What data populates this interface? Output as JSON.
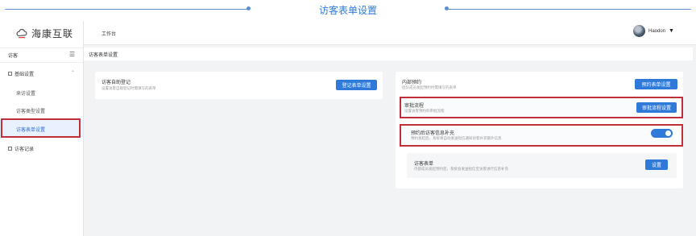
{
  "banner": {
    "title": "访客表单设置"
  },
  "sidebar": {
    "logo_text": "海康互联",
    "section_title": "访客",
    "groups": [
      {
        "label": "基础设置",
        "items": [
          "来访设置",
          "访客类型设置",
          "访客表单设置"
        ]
      },
      {
        "label": "访客记录",
        "items": []
      }
    ]
  },
  "header": {
    "breadcrumb": "工作台",
    "user_name": "Haodon"
  },
  "page": {
    "title": "访客表单设置"
  },
  "left_card": {
    "title": "访客自助登记",
    "desc": "设置访客自助登记时需填写的表单",
    "button": "登记表单设置"
  },
  "right_card": {
    "reservation": {
      "title": "内部预约",
      "desc": "团队成员发起预约时需填写的表单",
      "button": "预约表单设置"
    },
    "approval": {
      "title": "审批流程",
      "desc": "设置访客预约的审批流程",
      "button": "审批流程设置"
    },
    "supplement": {
      "title": "预约后访客信息补充",
      "desc": "预约发起后，系统将自动发送短信通知访客补充额外信息",
      "enabled": true
    },
    "visitor_form": {
      "title": "访客表单",
      "desc": "内部成员发起预约后，系统会发送短信至访客进行信息补充",
      "button": "设置"
    }
  },
  "colors": {
    "accent": "#2f7ad9",
    "highlight": "#c0303a"
  }
}
